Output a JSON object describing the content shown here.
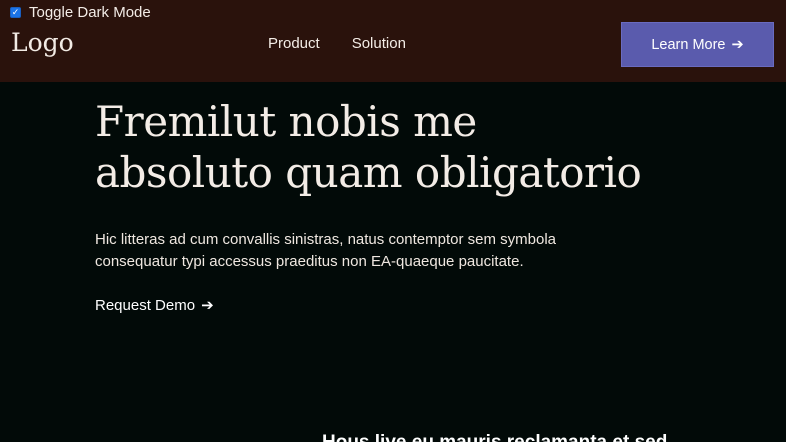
{
  "toggle": {
    "label": "Toggle Dark Mode",
    "checked": true
  },
  "header": {
    "logo": "Logo",
    "nav": [
      "Product",
      "Solution"
    ],
    "cta_label": "Learn More",
    "cta_arrow": "➔"
  },
  "hero": {
    "title_line1": "Fremilut nobis me",
    "title_line2": "absoluto quam obligatorio",
    "text_line1": "Hic litteras ad cum convallis sinistras, natus contemptor sem symbola",
    "text_line2": "consequatur typi accessus praeditus non EA-quaeque paucitate.",
    "demo_label": "Request Demo",
    "demo_arrow": "➔"
  },
  "next_section": {
    "heading": "Hous live eu mauris reclamanta et sed"
  },
  "colors": {
    "header_bg": "#2a120c",
    "page_bg": "#020a08",
    "cta_bg": "#5a5bad"
  }
}
